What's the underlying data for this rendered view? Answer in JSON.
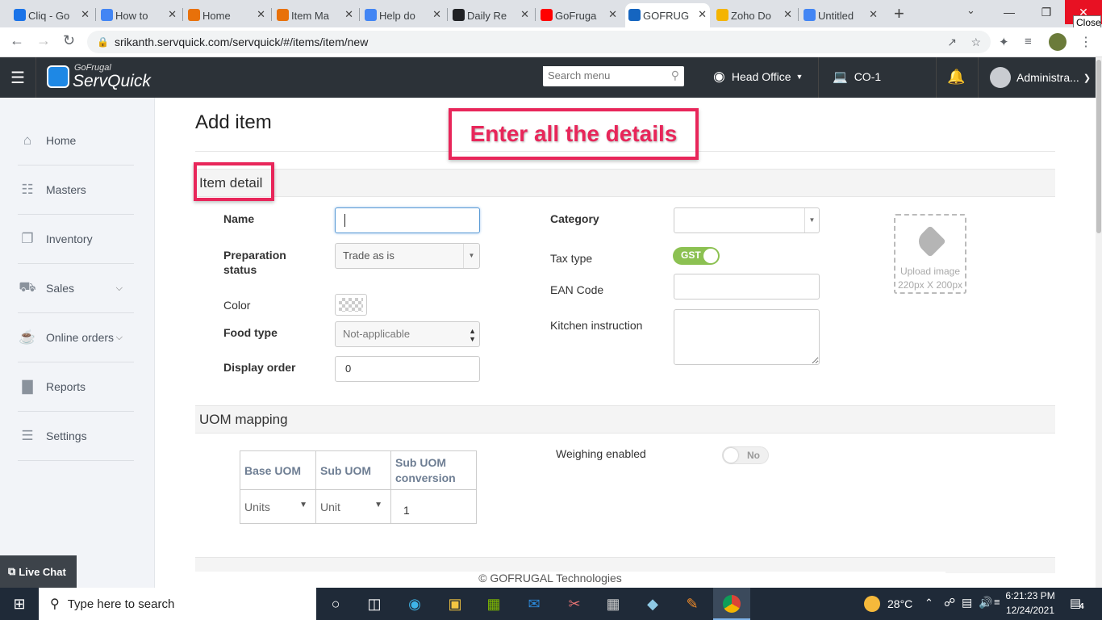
{
  "browser": {
    "tabs": [
      {
        "title": "Cliq - Go",
        "icon": "cliq-icon",
        "color": "#1a73e8"
      },
      {
        "title": "How to",
        "icon": "doc-icon",
        "color": "#4285f4"
      },
      {
        "title": "Home",
        "icon": "w-icon",
        "color": "#e8710a"
      },
      {
        "title": "Item Ma",
        "icon": "w-icon",
        "color": "#e8710a"
      },
      {
        "title": "Help do",
        "icon": "doc-icon",
        "color": "#4285f4"
      },
      {
        "title": "Daily Re",
        "icon": "c-icon",
        "color": "#202124"
      },
      {
        "title": "GoFruga",
        "icon": "youtube-icon",
        "color": "#ff0000"
      },
      {
        "title": "GOFRUG",
        "icon": "clock-icon",
        "color": "#1565c0"
      },
      {
        "title": "Zoho Do",
        "icon": "folder-icon",
        "color": "#f4b400"
      },
      {
        "title": "Untitled",
        "icon": "doc-icon",
        "color": "#4285f4"
      }
    ],
    "url": "srikanth.servquick.com/servquick/#/items/item/new",
    "close_tooltip": "Close"
  },
  "app": {
    "brand_top": "GoFrugal",
    "brand_main": "ServQuick",
    "search_placeholder": "Search menu",
    "location": "Head Office",
    "counter": "CO-1",
    "user": "Administra..."
  },
  "sidebar": {
    "items": [
      {
        "label": "Home",
        "icon": "home-icon"
      },
      {
        "label": "Masters",
        "icon": "masters-icon"
      },
      {
        "label": "Inventory",
        "icon": "inventory-icon"
      },
      {
        "label": "Sales",
        "icon": "cart-icon"
      },
      {
        "label": "Online orders",
        "icon": "online-orders-icon"
      },
      {
        "label": "Reports",
        "icon": "reports-icon"
      },
      {
        "label": "Settings",
        "icon": "settings-icon"
      }
    ],
    "live_chat": "Live Chat"
  },
  "page": {
    "title": "Add item",
    "annotation": "Enter all the details",
    "item_detail_heading": "Item detail",
    "fields": {
      "name_label": "Name",
      "name_value": "",
      "prep_label_1": "Preparation",
      "prep_label_2": "status",
      "prep_value": "Trade as is",
      "color_label": "Color",
      "food_label": "Food type",
      "food_value": "Not-applicable",
      "display_label": "Display order",
      "display_value": "0",
      "category_label": "Category",
      "category_value": "",
      "tax_label": "Tax type",
      "tax_value": "GST",
      "ean_label": "EAN Code",
      "ean_value": "",
      "kitchen_label": "Kitchen instruction",
      "kitchen_value": "",
      "upload_line1": "Upload image",
      "upload_line2": "220px X 200px"
    },
    "uom": {
      "heading": "UOM mapping",
      "headers": [
        "Base UOM",
        "Sub UOM",
        "Sub UOM conversion"
      ],
      "row": [
        "Units",
        "Unit",
        "1"
      ],
      "weighing_label": "Weighing enabled",
      "weighing_value": "No"
    },
    "footer": "© GOFRUGAL Technologies"
  },
  "taskbar": {
    "search_placeholder": "Type here to search",
    "temperature": "28°C",
    "time": "6:21:23 PM",
    "date": "12/24/2021",
    "notifications": "4"
  }
}
